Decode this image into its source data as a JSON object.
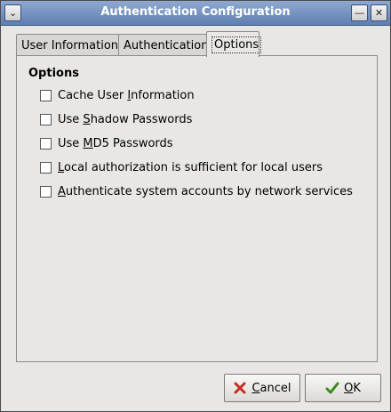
{
  "window": {
    "title": "Authentication Configuration"
  },
  "tabs": [
    {
      "label": "User Information"
    },
    {
      "label": "Authentication"
    },
    {
      "label": "Options",
      "selected": true
    }
  ],
  "options": {
    "group_title": "Options",
    "items": [
      {
        "pre": "Cache User ",
        "mnemonic": "I",
        "post": "nformation",
        "checked": false
      },
      {
        "pre": "Use ",
        "mnemonic": "S",
        "post": "hadow Passwords",
        "checked": false
      },
      {
        "pre": "Use ",
        "mnemonic": "M",
        "post": "D5 Passwords",
        "checked": false
      },
      {
        "pre": "",
        "mnemonic": "L",
        "post": "ocal authorization is sufficient for local users",
        "checked": false
      },
      {
        "pre": "",
        "mnemonic": "A",
        "post": "uthenticate system accounts by network services",
        "checked": false
      }
    ]
  },
  "buttons": {
    "cancel": {
      "mnemonic": "C",
      "rest": "ancel",
      "icon": "cancel-x-icon"
    },
    "ok": {
      "mnemonic": "O",
      "rest": "K",
      "icon": "ok-check-icon"
    }
  },
  "colors": {
    "titlebar": "#6f8cbf",
    "cancel_icon": "#c62d1f",
    "ok_icon": "#3a8a1f"
  }
}
